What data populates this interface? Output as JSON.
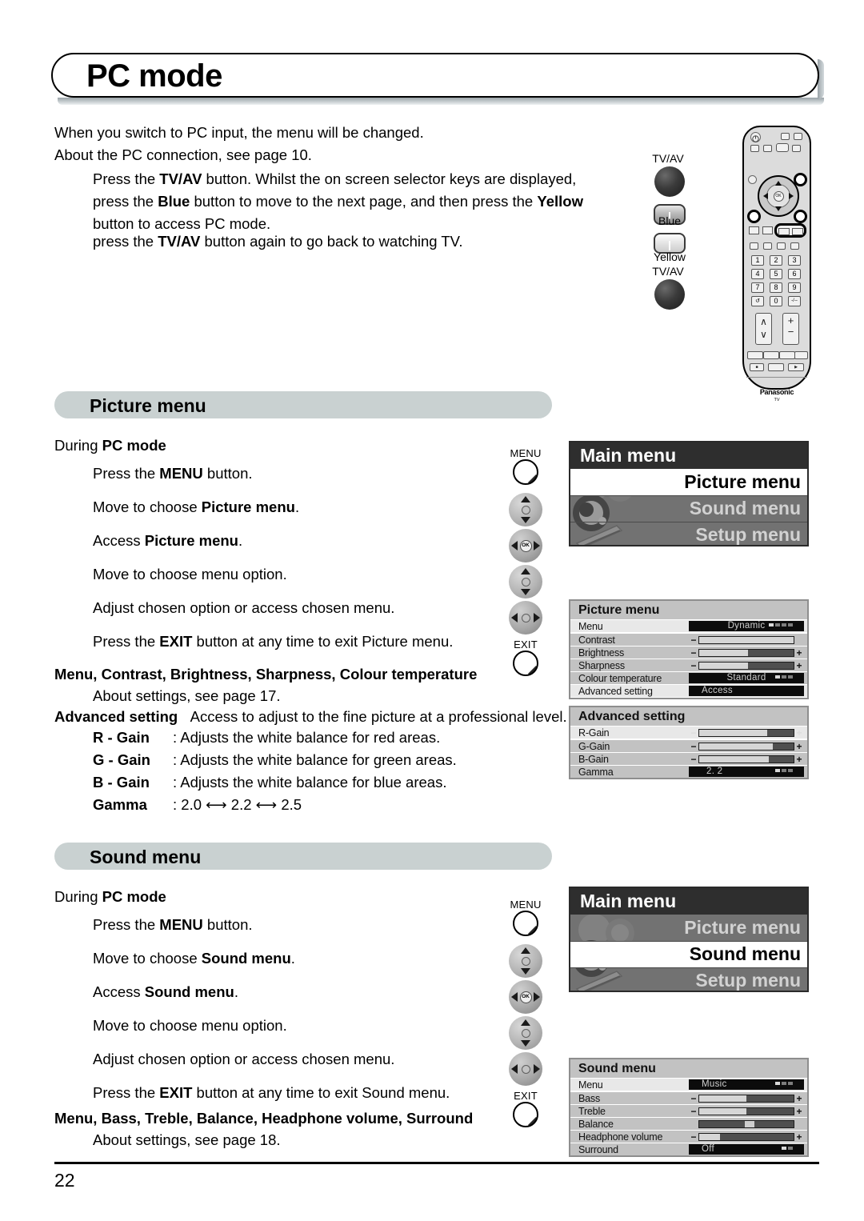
{
  "page": {
    "title": "PC mode",
    "number": "22"
  },
  "intro": {
    "line1": "When you switch to PC input, the menu will be changed.",
    "line2": "About the PC connection, see page 10.",
    "para1_a": "Press the ",
    "para1_b": "TV/AV",
    "para1_c": " button. Whilst the on screen selector keys are displayed, press the ",
    "para1_d": "Blue",
    "para1_e": " button to move to the next page, and then press the ",
    "para1_f": "Yellow",
    "para1_g": " button to access PC mode.",
    "para2_a": "press the ",
    "para2_b": "TV/AV",
    "para2_c": " button again to go back to watching TV."
  },
  "remote_illustration": {
    "tvav_top_label": "TV/AV",
    "blue_label": "Blue",
    "yellow_label": "Yellow",
    "tvav_bottom_label": "TV/AV",
    "brand": "Panasonic",
    "brand_sub": "TV",
    "numbers": [
      "1",
      "2",
      "3",
      "4",
      "5",
      "6",
      "7",
      "8",
      "9",
      "0"
    ],
    "zero_row_left": "↺",
    "zero_row_right": "-/--",
    "channel_up": "∧",
    "channel_down": "∨",
    "volume_up": "+",
    "volume_down": "−",
    "ok": "OK"
  },
  "picture_section": {
    "heading": "Picture menu",
    "during_label_a": "During ",
    "during_label_b": "PC mode",
    "steps": [
      {
        "pre": "Press the ",
        "bold": "MENU",
        "post": " button.",
        "key": "menu"
      },
      {
        "pre": "Move to choose ",
        "bold": "Picture menu",
        "post": ".",
        "key": "updown"
      },
      {
        "pre": "Access ",
        "bold": "Picture menu",
        "post": ".",
        "key": "ok"
      },
      {
        "pre": "Move to choose menu option.",
        "bold": "",
        "post": "",
        "key": "updown"
      },
      {
        "pre": "Adjust chosen option or access chosen menu.",
        "bold": "",
        "post": "",
        "key": "leftright"
      },
      {
        "pre": "Press the ",
        "bold": "EXIT",
        "post": " button at any time to exit Picture menu.",
        "key": "exit"
      }
    ],
    "key_labels": {
      "menu": "MENU",
      "exit": "EXIT"
    },
    "settings_title": "Menu, Contrast, Brightness, Sharpness, Colour temperature",
    "settings_note": "About settings, see page 17.",
    "advanced_label": "Advanced setting",
    "advanced_desc": "Access to adjust to the fine picture at a professional level.",
    "gain_rows": [
      {
        "label": "R - Gain",
        "desc": ": Adjusts the white balance for red areas."
      },
      {
        "label": "G - Gain",
        "desc": ": Adjusts the white balance for green areas."
      },
      {
        "label": "B - Gain",
        "desc": ": Adjusts the white balance for blue areas."
      }
    ],
    "gamma_label": "Gamma",
    "gamma_values": ": 2.0 ⟷ 2.2 ⟷ 2.5"
  },
  "sound_section": {
    "heading": "Sound menu",
    "during_label_a": "During ",
    "during_label_b": "PC mode",
    "steps": [
      {
        "pre": "Press the ",
        "bold": "MENU",
        "post": " button.",
        "key": "menu"
      },
      {
        "pre": "Move to choose ",
        "bold": "Sound menu",
        "post": ".",
        "key": "updown"
      },
      {
        "pre": "Access ",
        "bold": "Sound menu",
        "post": ".",
        "key": "ok"
      },
      {
        "pre": "Move to choose menu option.",
        "bold": "",
        "post": "",
        "key": "updown"
      },
      {
        "pre": "Adjust chosen option or access chosen menu.",
        "bold": "",
        "post": "",
        "key": "leftright"
      },
      {
        "pre": "Press the ",
        "bold": "EXIT",
        "post": " button at any time to exit Sound menu.",
        "key": "exit"
      }
    ],
    "key_labels": {
      "menu": "MENU",
      "exit": "EXIT"
    },
    "settings_title": "Menu, Bass, Treble, Balance, Headphone volume, Surround",
    "settings_note": "About settings, see page 18."
  },
  "osd_main_menu_picture": {
    "title": "Main menu",
    "items": [
      {
        "label": "Picture menu",
        "selected": true
      },
      {
        "label": "Sound menu",
        "selected": false
      },
      {
        "label": "Setup menu",
        "selected": false
      }
    ]
  },
  "osd_main_menu_sound": {
    "title": "Main menu",
    "items": [
      {
        "label": "Picture menu",
        "selected": false
      },
      {
        "label": "Sound menu",
        "selected": true
      },
      {
        "label": "Setup menu",
        "selected": false
      }
    ]
  },
  "osd_picture_menu": {
    "title": "Picture menu",
    "rows": [
      {
        "name": "Menu",
        "type": "option",
        "value": "Dynamic",
        "dots": 4,
        "dot_active": 1,
        "highlight": true
      },
      {
        "name": "Contrast",
        "type": "slider",
        "fill": 100,
        "minus": "−",
        "plus": "",
        "highlight": false
      },
      {
        "name": "Brightness",
        "type": "slider",
        "fill": 52,
        "minus": "−",
        "plus": "+",
        "highlight": false
      },
      {
        "name": "Sharpness",
        "type": "slider",
        "fill": 52,
        "minus": "−",
        "plus": "+",
        "highlight": false
      },
      {
        "name": "Colour temperature",
        "type": "option",
        "value": "Standard",
        "dots": 3,
        "dot_active": 1,
        "highlight": false
      },
      {
        "name": "Advanced setting",
        "type": "option",
        "value": "Access",
        "dots": 0,
        "dot_active": 0,
        "highlight": true
      }
    ]
  },
  "osd_advanced_setting": {
    "title": "Advanced setting",
    "rows": [
      {
        "name": "R-Gain",
        "type": "slider",
        "fill": 72,
        "minus": "−",
        "plus": "+",
        "highlight": true
      },
      {
        "name": "G-Gain",
        "type": "slider",
        "fill": 78,
        "minus": "−",
        "plus": "+",
        "highlight": false
      },
      {
        "name": "B-Gain",
        "type": "slider",
        "fill": 74,
        "minus": "−",
        "plus": "+",
        "highlight": false
      },
      {
        "name": "Gamma",
        "type": "option",
        "value": "2. 2",
        "dots": 3,
        "dot_active": 1,
        "highlight": false
      }
    ]
  },
  "osd_sound_menu": {
    "title": "Sound menu",
    "rows": [
      {
        "name": "Menu",
        "type": "option",
        "value": "Music",
        "dots": 3,
        "dot_active": 1,
        "highlight": true
      },
      {
        "name": "Bass",
        "type": "slider",
        "fill": 50,
        "minus": "−",
        "plus": "+",
        "highlight": false
      },
      {
        "name": "Treble",
        "type": "slider",
        "fill": 50,
        "minus": "−",
        "plus": "+",
        "highlight": false
      },
      {
        "name": "Balance",
        "type": "balance",
        "knob": 48,
        "highlight": false
      },
      {
        "name": "Headphone volume",
        "type": "slider",
        "fill": 22,
        "minus": "−",
        "plus": "+",
        "highlight": false
      },
      {
        "name": "Surround",
        "type": "option",
        "value": "Off",
        "dots": 2,
        "dot_active": 1,
        "highlight": false
      }
    ]
  }
}
